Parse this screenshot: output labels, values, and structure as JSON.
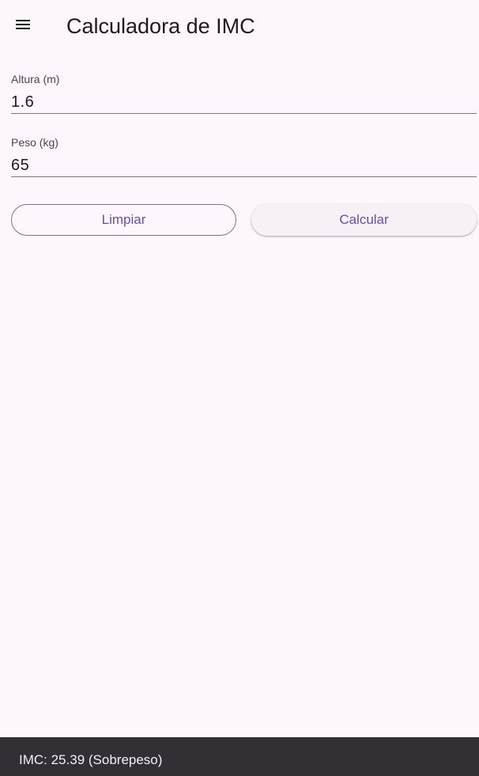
{
  "app_bar": {
    "menu_icon": "menu-icon",
    "title": "Calculadora de IMC"
  },
  "form": {
    "height": {
      "label": "Altura (m)",
      "value": "1.6"
    },
    "weight": {
      "label": "Peso (kg)",
      "value": "65"
    }
  },
  "actions": {
    "clear_label": "Limpiar",
    "calculate_label": "Calcular"
  },
  "snackbar": {
    "message": "IMC: 25.39 (Sobrepeso)"
  },
  "colors": {
    "background": "#fdf7fd",
    "primary": "#6750a4",
    "snackbar_bg": "#322f35",
    "outline": "#79747e"
  }
}
